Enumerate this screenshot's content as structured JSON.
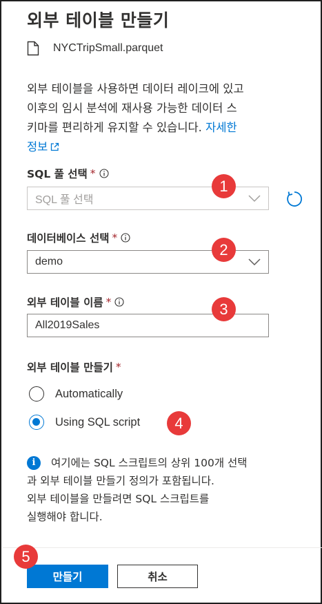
{
  "header": {
    "title": "외부 테이블 만들기",
    "file_name": "NYCTripSmall.parquet"
  },
  "description": {
    "line1": "외부 테이블을 사용하면 데이터 레이크에 있고",
    "line2": "이후의 임시 분석에 재사용 가능한 데이터 스",
    "line3_prefix": "키마를 편리하게 유지할 수 있습니다. ",
    "link_part1": "자세한",
    "link_part2": "정보"
  },
  "sql_pool": {
    "label": "SQL 풀 선택",
    "required": "*",
    "placeholder": "SQL 풀 선택"
  },
  "database": {
    "label": "데이터베이스 선택",
    "required": "*",
    "value": "demo"
  },
  "table_name": {
    "label": "외부 테이블 이름",
    "required": "*",
    "value": "All2019Sales"
  },
  "create_method": {
    "label": "외부 테이블 만들기",
    "required": "*",
    "options": [
      {
        "label": "Automatically",
        "selected": false
      },
      {
        "label": "Using SQL script",
        "selected": true
      }
    ]
  },
  "info_note": {
    "icon": "info-icon",
    "line1": "여기에는 SQL 스크립트의 상위 100개 선택",
    "line2": "과 외부 테이블 만들기 정의가 포함됩니다.",
    "line3": "외부 테이블을 만들려면 SQL 스크립트를",
    "line4": "실행해야 합니다."
  },
  "footer": {
    "create_label": "만들기",
    "cancel_label": "취소"
  },
  "callouts": [
    "1",
    "2",
    "3",
    "4",
    "5"
  ],
  "colors": {
    "accent": "#0078d4",
    "required": "#a4262c",
    "callout": "#e83a3a",
    "text": "#323130"
  }
}
